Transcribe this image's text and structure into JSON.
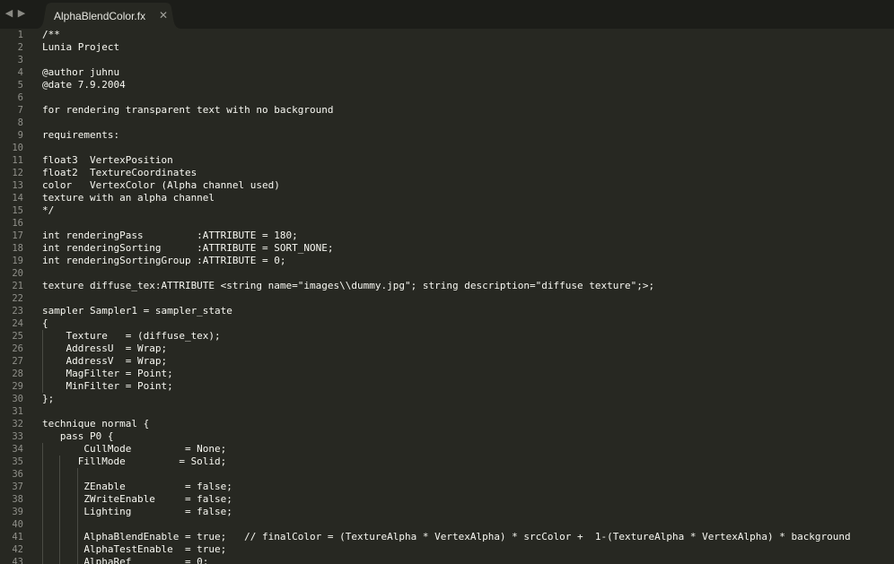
{
  "tab": {
    "title": "AlphaBlendColor.fx",
    "close_glyph": "✕"
  },
  "nav": {
    "back_glyph": "◀",
    "forward_glyph": "▶"
  },
  "colors": {
    "editor_bg": "#272822",
    "tabbar_bg": "#1c1d19",
    "text": "#f8f8f2",
    "line_number": "#90908a"
  },
  "lines": [
    {
      "n": "1",
      "text": "/**"
    },
    {
      "n": "2",
      "text": "Lunia Project"
    },
    {
      "n": "3",
      "text": ""
    },
    {
      "n": "4",
      "text": "@author juhnu"
    },
    {
      "n": "5",
      "text": "@date 7.9.2004"
    },
    {
      "n": "6",
      "text": ""
    },
    {
      "n": "7",
      "text": "for rendering transparent text with no background"
    },
    {
      "n": "8",
      "text": ""
    },
    {
      "n": "9",
      "text": "requirements:"
    },
    {
      "n": "10",
      "text": ""
    },
    {
      "n": "11",
      "text": "float3  VertexPosition"
    },
    {
      "n": "12",
      "text": "float2  TextureCoordinates"
    },
    {
      "n": "13",
      "text": "color   VertexColor (Alpha channel used)"
    },
    {
      "n": "14",
      "text": "texture with an alpha channel"
    },
    {
      "n": "15",
      "text": "*/"
    },
    {
      "n": "16",
      "text": ""
    },
    {
      "n": "17",
      "text": "int renderingPass         :ATTRIBUTE = 180;"
    },
    {
      "n": "18",
      "text": "int renderingSorting      :ATTRIBUTE = SORT_NONE;"
    },
    {
      "n": "19",
      "text": "int renderingSortingGroup :ATTRIBUTE = 0;"
    },
    {
      "n": "20",
      "text": ""
    },
    {
      "n": "21",
      "text": "texture diffuse_tex:ATTRIBUTE <string name=\"images\\\\dummy.jpg\"; string description=\"diffuse texture\";>;"
    },
    {
      "n": "22",
      "text": ""
    },
    {
      "n": "23",
      "text": "sampler Sampler1 = sampler_state"
    },
    {
      "n": "24",
      "text": "{"
    },
    {
      "n": "25",
      "text": "    Texture   = (diffuse_tex);"
    },
    {
      "n": "26",
      "text": "    AddressU  = Wrap;"
    },
    {
      "n": "27",
      "text": "    AddressV  = Wrap;"
    },
    {
      "n": "28",
      "text": "    MagFilter = Point;"
    },
    {
      "n": "29",
      "text": "    MinFilter = Point;"
    },
    {
      "n": "30",
      "text": "};"
    },
    {
      "n": "31",
      "text": ""
    },
    {
      "n": "32",
      "text": "technique normal {"
    },
    {
      "n": "33",
      "text": "   pass P0 {"
    },
    {
      "n": "34",
      "text": "       CullMode         = None;"
    },
    {
      "n": "35",
      "text": "      FillMode         = Solid;"
    },
    {
      "n": "36",
      "text": ""
    },
    {
      "n": "37",
      "text": "       ZEnable          = false;"
    },
    {
      "n": "38",
      "text": "       ZWriteEnable     = false;"
    },
    {
      "n": "39",
      "text": "       Lighting         = false;"
    },
    {
      "n": "40",
      "text": ""
    },
    {
      "n": "41",
      "text": "       AlphaBlendEnable = true;   // finalColor = (TextureAlpha * VertexAlpha) * srcColor +  1-(TextureAlpha * VertexAlpha) * background"
    },
    {
      "n": "42",
      "text": "       AlphaTestEnable  = true;"
    },
    {
      "n": "43",
      "text": "       AlphaRef         = 0;"
    }
  ]
}
